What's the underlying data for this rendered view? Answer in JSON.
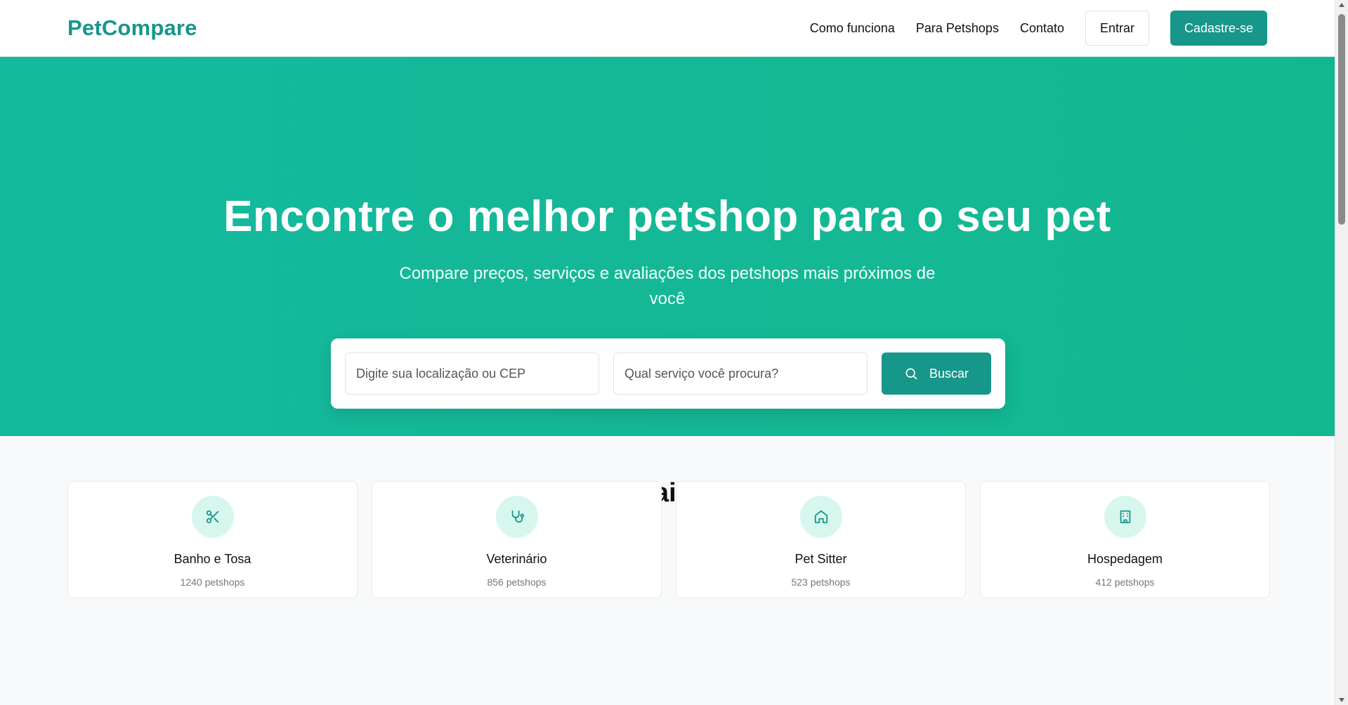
{
  "header": {
    "logo": "PetCompare",
    "nav": [
      "Como funciona",
      "Para Petshops",
      "Contato"
    ],
    "login_label": "Entrar",
    "signup_label": "Cadastre-se"
  },
  "hero": {
    "title": "Encontre o melhor petshop para o seu pet",
    "subtitle": "Compare preços, serviços e avaliações dos petshops mais próximos de você",
    "search": {
      "location_placeholder": "Digite sua localização ou CEP",
      "service_placeholder": "Qual serviço você procura?",
      "button_label": "Buscar",
      "button_icon": "search-icon"
    }
  },
  "services": {
    "title": "Serviços mais buscados",
    "items": [
      {
        "name": "Banho e Tosa",
        "count": "1240 petshops",
        "icon": "scissors-icon"
      },
      {
        "name": "Veterinário",
        "count": "856 petshops",
        "icon": "stethoscope-icon"
      },
      {
        "name": "Pet Sitter",
        "count": "523 petshops",
        "icon": "home-icon"
      },
      {
        "name": "Hospedagem",
        "count": "412 petshops",
        "icon": "building-icon"
      }
    ]
  },
  "colors": {
    "brand": "#17968a",
    "hero_gradient_start": "#15b99e",
    "hero_gradient_end": "#13b78f",
    "icon_bg": "#d7f7ee"
  }
}
